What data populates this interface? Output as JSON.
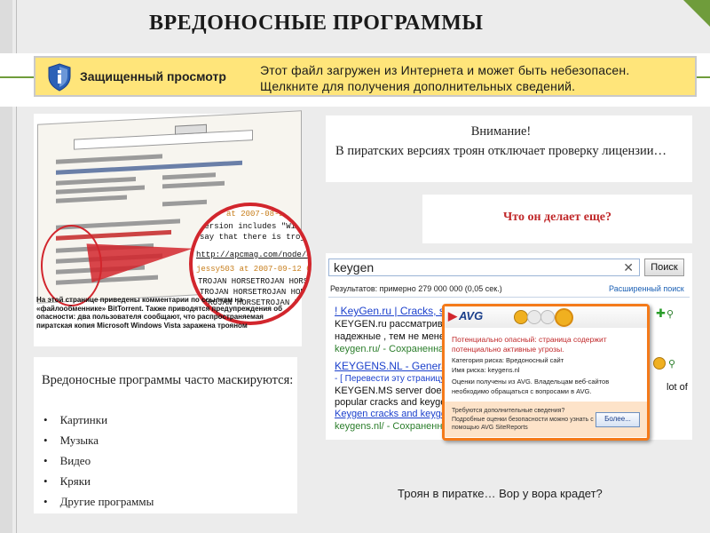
{
  "slide": {
    "title": "ВРЕДОНОСНЫЕ ПРОГРАММЫ"
  },
  "warning_bar": {
    "title": "Защищенный просмотр",
    "message_line1": "Этот файл загружен из Интернета и может быть небезопасен.",
    "message_line2": "Щелкните для получения дополнительных сведений.",
    "icon": "shield-info-icon"
  },
  "torrent_screenshot": {
    "zoom_lines": [
      "at 2007-08-2",
      "version includes \"Win",
      "say that there is trojan",
      "http://apcmag.com/node/47",
      "jessy503 at 2007-09-12 09:",
      "TROJAN HORSETROJAN HORSE",
      "TROJAN HORSETROJAN HORSE",
      "TROJAN HORSETROJAN HORSE"
    ],
    "caption": "На этой странице приведены комментарии по ссылкам на «файлообменнике» BitTorrent. Также приводятся предупреждения об опасности: два пользователя сообщают, что распространяемая пиратская копия Microsoft Windows Vista заражена трояном"
  },
  "left_box": {
    "lead": "Вредоносные программы часто маскируются:",
    "items": [
      "Картинки",
      "Музыка",
      "Видео",
      "Кряки",
      "Другие программы"
    ]
  },
  "attention_box": {
    "line1": "Внимание!",
    "line2": "В пиратских версиях троян отключает проверку лицензии…"
  },
  "question_box": {
    "text": "Что он делает еще?"
  },
  "search_screenshot": {
    "query": "keygen",
    "search_button": "Поиск",
    "results_meta": "Результатов: примерно 279 000 000 (0,05 сек.)",
    "advanced_link": "Расширенный поиск",
    "results": [
      {
        "title": "! KeyGen.ru | Cracks, s",
        "snippet1": "KEYGEN.ru рассматривает",
        "snippet2": "надежные , тем не менее б",
        "url": "keygen.ru/ - Сохраненная"
      },
      {
        "title": "KEYGENS.NL - Genera",
        "translate": "- [ Перевести эту страницу",
        "snippet1": "KEYGEN.MS server doesn't",
        "snippet2": "popular cracks and keygens",
        "extra_link": "Keygen cracks and keygens",
        "url": "keygens.nl/ - Сохраненная"
      }
    ],
    "trailing_text": "lot of",
    "avg_popup": {
      "brand": "AVG",
      "warning": "Потенциально опасный: страница содержит потенциально активные угрозы.",
      "category": "Категория риска: Вредоносный сайт",
      "risk_name": "Имя риска: keygens.nl",
      "ratings": "Оценки получены из AVG. Владельцам веб-сайтов необходимо обращаться с вопросами в AVG.",
      "footer": "Требуются дополнительные сведения? Подробные оценки безопасности можно узнать с помощью AVG SiteReports",
      "more_button": "Более..."
    }
  },
  "bottom_caption": "Троян в пиратке… Вор у вора крадет?",
  "colors": {
    "accent_green": "#6f9c3b",
    "warning_yellow": "#ffe57a",
    "alert_red": "#c0282a",
    "avg_orange": "#f47a1a"
  }
}
